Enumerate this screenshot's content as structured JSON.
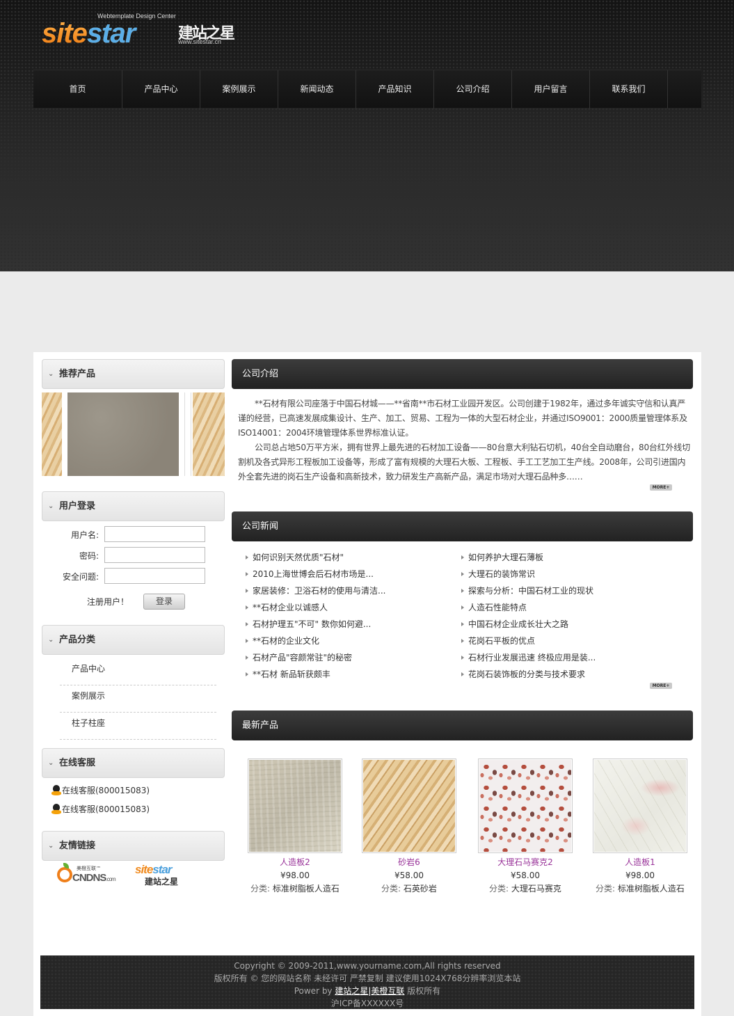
{
  "logo": {
    "subtitle": "Webtemplate Design Center",
    "main_orange": "site",
    "main_blue": "star",
    "chinese": "建站之星",
    "url": "www.sitestar.cn"
  },
  "nav": {
    "items": [
      {
        "label": "首页"
      },
      {
        "label": "产品中心"
      },
      {
        "label": "案例展示"
      },
      {
        "label": "新闻动态"
      },
      {
        "label": "产品知识"
      },
      {
        "label": "公司介绍"
      },
      {
        "label": "用户留言"
      },
      {
        "label": "联系我们"
      }
    ]
  },
  "sidebar": {
    "recommended": {
      "title": "推荐产品"
    },
    "login": {
      "title": "用户登录",
      "username_label": "用户名:",
      "password_label": "密码:",
      "security_label": "安全问题:",
      "register_text": "注册用户！",
      "login_button": "登录"
    },
    "categories": {
      "title": "产品分类",
      "items": [
        {
          "label": "产品中心"
        },
        {
          "label": "案例展示"
        },
        {
          "label": "柱子柱座"
        }
      ]
    },
    "service": {
      "title": "在线客服",
      "items": [
        {
          "label": "在线客服(800015083)"
        },
        {
          "label": "在线客服(800015083)"
        }
      ]
    },
    "links": {
      "title": "友情链接",
      "ocn": {
        "text": "CNDNS",
        "com": ".com",
        "top": "美橙互联™"
      },
      "sitestar": {
        "orange": "site",
        "blue": "star",
        "cn": "建站之星"
      }
    }
  },
  "main": {
    "intro": {
      "title": "公司介绍",
      "p1": "**石材有限公司座落于中国石材城——**省南**市石材工业园开发区。公司创建于1982年，通过多年诚实守信和认真严谨的经营，已高速发展成集设计、生产、加工、贸易、工程为一体的大型石材企业，并通过ISO9001：2000质量管理体系及ISO14001：2004环境管理体系世界标准认证。",
      "p2": "公司总占地50万平方米，拥有世界上最先进的石材加工设备——80台意大利钻石切机，40台全自动磨台，80台红外线切割机及各式异形工程板加工设备等，形成了富有规模的大理石大板、工程板、手工工艺加工生产线。2008年，公司引进国内外全套先进的岗石生产设备和高新技术，致力研发生产高新产品，满足市场对大理石品种多……",
      "more": "MORE+"
    },
    "news": {
      "title": "公司新闻",
      "left": [
        "如何识别天然优质\"石材\"",
        "2010上海世博会后石材市场是...",
        "家居装修：卫浴石材的使用与清洁...",
        "**石材企业以诚感人",
        "石材护理五\"不可\" 数你如何避...",
        "**石材的企业文化",
        "石材产品\"容颜常驻\"的秘密",
        "**石材 新品斩获颇丰"
      ],
      "right": [
        "如何养护大理石薄板",
        "大理石的装饰常识",
        "探索与分析：中国石材工业的现状",
        "人造石性能特点",
        "中国石材企业成长壮大之路",
        "花岗石平板的优点",
        "石材行业发展迅速 终极应用是装...",
        "花岗石装饰板的分类与技术要求"
      ],
      "more": "MORE+"
    },
    "products": {
      "title": "最新产品",
      "category_label": "分类:",
      "items": [
        {
          "name": "人造板2",
          "price": "¥98.00",
          "category": "标准树脂板人造石"
        },
        {
          "name": "砂岩6",
          "price": "¥58.00",
          "category": "石英砂岩"
        },
        {
          "name": "大理石马赛克2",
          "price": "¥58.00",
          "category": "大理石马赛克"
        },
        {
          "name": "人造板1",
          "price": "¥98.00",
          "category": "标准树脂板人造石"
        }
      ]
    }
  },
  "footer": {
    "copyright": "Copyright © 2009-2011,www.yourname.com,All rights reserved",
    "rights": "版权所有 © 您的网站名称 未经许可 严禁复制 建议使用1024X768分辨率浏览本站",
    "power_prefix": "Power by ",
    "power_link1": "建站之星",
    "power_sep": "|",
    "power_link2": "美橙互联",
    "power_suffix": " 版权所有",
    "icp": "沪ICP备XXXXXX号"
  }
}
